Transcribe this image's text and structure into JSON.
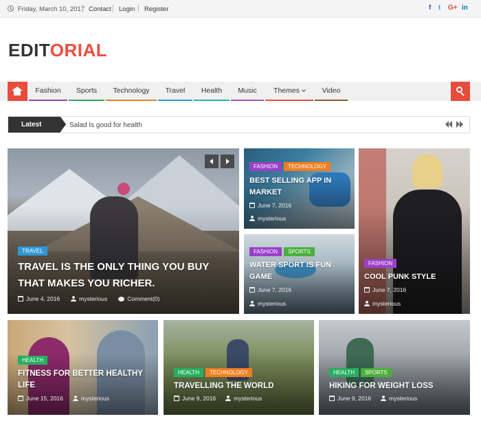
{
  "topbar": {
    "date": "Friday, March 10, 2017",
    "links": [
      "Contact",
      "Login",
      "Register"
    ],
    "social": [
      {
        "icon": "facebook-icon",
        "glyph": "f",
        "color": "#3b5998"
      },
      {
        "icon": "twitter-icon",
        "glyph": "t",
        "color": "#1da1f2"
      },
      {
        "icon": "google-plus-icon",
        "glyph": "G+",
        "color": "#dd4b39"
      },
      {
        "icon": "linkedin-icon",
        "glyph": "in",
        "color": "#0077b5"
      }
    ]
  },
  "logo": {
    "part1": "EDIT",
    "part2": "ORIAL",
    "color_dark": "#333333",
    "color_accent": "#ec4d3e"
  },
  "nav": {
    "items": [
      {
        "label": "Fashion",
        "color": "#8e44ad"
      },
      {
        "label": "Sports",
        "color": "#27ae60"
      },
      {
        "label": "Technology",
        "color": "#e67e22"
      },
      {
        "label": "Travel",
        "color": "#3498db"
      },
      {
        "label": "Health",
        "color": "#1abc9c"
      },
      {
        "label": "Music",
        "color": "#9b59b6"
      },
      {
        "label": "Themes",
        "color": "#e74c3c"
      },
      {
        "label": "Video",
        "color": "#8b5a2b"
      }
    ],
    "accent": "#e74c3c"
  },
  "ticker": {
    "label": "Latest",
    "headline": "Salad Is good for health"
  },
  "featured": {
    "badge": "TRAVEL",
    "title": "TRAVEL IS THE ONLY THING YOU BUY THAT MAKES YOU RICHER.",
    "date": "June 4, 2016",
    "author": "mysterious",
    "comments": "Comment(0)"
  },
  "cards": [
    {
      "badges": [
        "FASHION",
        "TECHNOLOGY"
      ],
      "title": "BEST SELLING APP IN MARKET",
      "date": "June 7, 2016",
      "author": "mysterious"
    },
    {
      "badges": [
        "FASHION"
      ],
      "title": "COOL PUNK STYLE",
      "date": "June 7, 2016",
      "author": "mysterious"
    },
    {
      "badges": [
        "FASHION",
        "SPORTS"
      ],
      "title": "WATER SPORT IS FUN GAME",
      "date": "June 7, 2016",
      "author": "mysterious"
    },
    {
      "badges": [
        "HEALTH"
      ],
      "title": "FITNESS FOR BETTER HEALTHY LIFE",
      "date": "June 15, 2016",
      "author": "mysterious"
    },
    {
      "badges": [
        "HEALTH",
        "TECHNOLOGY"
      ],
      "title": "TRAVELLING THE WORLD",
      "date": "June 9, 2016",
      "author": "mysterious"
    },
    {
      "badges": [
        "HEALTH",
        "SPORTS"
      ],
      "title": "HIKING FOR WEIGHT LOSS",
      "date": "June 9, 2016",
      "author": "mysterious"
    }
  ],
  "badge_colors": {
    "FASHION": "#9b3fc9",
    "TECHNOLOGY": "#f07e20",
    "TRAVEL": "#2e9ad8",
    "SPORTS": "#4caf3c",
    "HEALTH": "#27ae60"
  }
}
